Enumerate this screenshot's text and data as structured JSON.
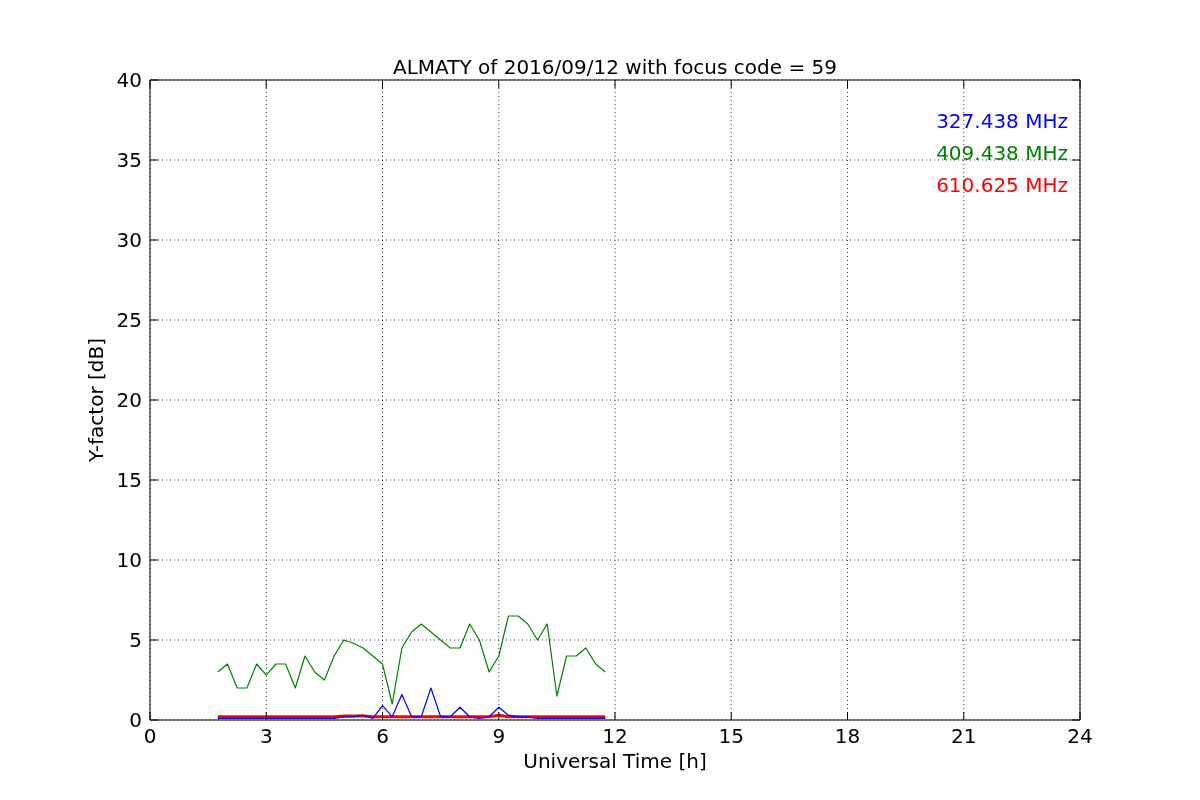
{
  "chart_data": {
    "type": "line",
    "title": "ALMATY of 2016/09/12 with focus code = 59",
    "xlabel": "Universal Time [h]",
    "ylabel": "Y-factor [dB]",
    "x": [
      1.75,
      2,
      2.25,
      2.5,
      2.75,
      3,
      3.25,
      3.5,
      3.75,
      4,
      4.25,
      4.5,
      4.75,
      5,
      5.25,
      5.5,
      5.75,
      6,
      6.25,
      6.5,
      6.75,
      7,
      7.25,
      7.5,
      7.75,
      8,
      8.25,
      8.5,
      8.75,
      9,
      9.25,
      9.5,
      9.75,
      10,
      10.25,
      10.5,
      10.75,
      11,
      11.25,
      11.5,
      11.75
    ],
    "series": [
      {
        "name": "327.438 MHz",
        "color": "#0000ff",
        "values": [
          0.1,
          0.1,
          0.1,
          0.1,
          0.1,
          0.1,
          0.1,
          0.1,
          0.1,
          0.1,
          0.1,
          0.1,
          0.1,
          0.2,
          0.2,
          0.3,
          0.1,
          0.9,
          0.2,
          1.6,
          0.2,
          0.2,
          2.0,
          0.2,
          0.2,
          0.8,
          0.2,
          0.1,
          0.2,
          0.8,
          0.3,
          0.2,
          0.2,
          0.1,
          0.1,
          0.1,
          0.1,
          0.1,
          0.1,
          0.1,
          0.1
        ]
      },
      {
        "name": "409.438 MHz",
        "color": "#008000",
        "values": [
          3,
          3.5,
          2,
          2,
          3.5,
          2.8,
          3.5,
          3.5,
          2,
          4,
          3,
          2.5,
          4,
          5,
          4.8,
          4.5,
          4,
          3.5,
          1,
          4.5,
          5.5,
          6,
          5.5,
          5,
          4.5,
          4.5,
          6,
          5,
          3,
          4,
          6.5,
          6.5,
          6,
          5,
          6,
          1.5,
          4,
          4,
          4.5,
          3.5,
          3
        ]
      },
      {
        "name": "610.625 MHz",
        "color": "#ff0000",
        "values": [
          0.2,
          0.2,
          0.2,
          0.2,
          0.2,
          0.2,
          0.2,
          0.2,
          0.2,
          0.2,
          0.2,
          0.2,
          0.2,
          0.25,
          0.25,
          0.25,
          0.2,
          0.2,
          0.2,
          0.2,
          0.2,
          0.2,
          0.2,
          0.2,
          0.2,
          0.2,
          0.2,
          0.2,
          0.2,
          0.3,
          0.2,
          0.2,
          0.2,
          0.2,
          0.2,
          0.2,
          0.2,
          0.2,
          0.2,
          0.2,
          0.2
        ]
      }
    ],
    "grid": true,
    "xlim": [
      0,
      24
    ],
    "ylim": [
      0,
      40
    ],
    "xticks": [
      0,
      3,
      6,
      9,
      12,
      15,
      18,
      21,
      24
    ],
    "yticks": [
      0,
      5,
      10,
      15,
      20,
      25,
      30,
      35,
      40
    ]
  }
}
